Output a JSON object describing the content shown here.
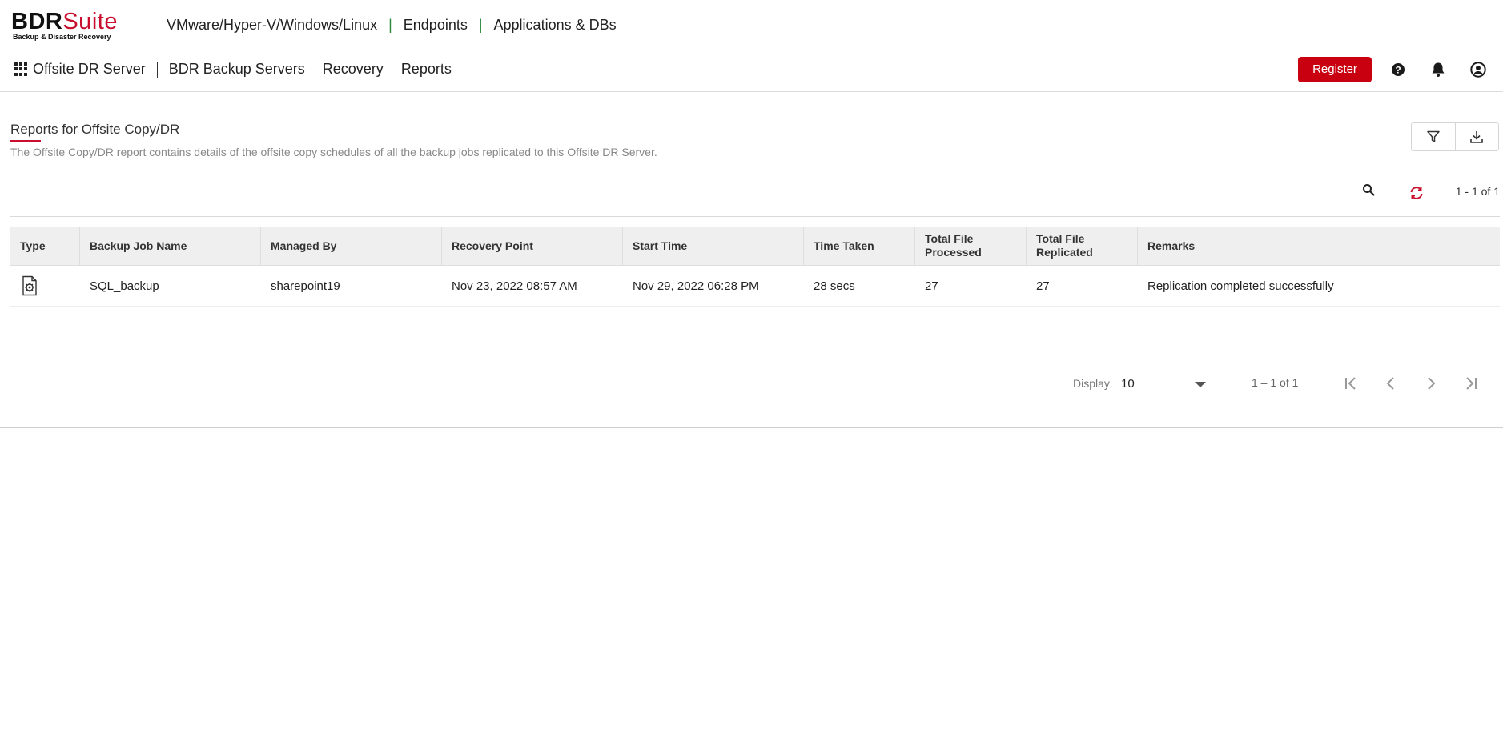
{
  "logo": {
    "brand_prefix": "BDR",
    "brand_suffix": "Suite",
    "tagline": "Backup & Disaster Recovery"
  },
  "product_tabs": [
    {
      "label": "VMware/Hyper-V/Windows/Linux",
      "active": false
    },
    {
      "label": "Endpoints",
      "active": false
    },
    {
      "label": "Applications & DBs",
      "active": true
    }
  ],
  "product_tab_separator": "|",
  "nav": {
    "title": "Offsite DR Server",
    "links": [
      "BDR Backup Servers",
      "Recovery",
      "Reports"
    ],
    "register_label": "Register"
  },
  "page": {
    "title": "Reports for Offsite Copy/DR",
    "description": "The Offsite Copy/DR report contains details of the offsite copy schedules of all the backup jobs replicated to this Offsite DR Server."
  },
  "toolbar": {
    "range_text": "1 - 1 of 1"
  },
  "table": {
    "columns": [
      [
        "Type"
      ],
      [
        "Backup Job Name"
      ],
      [
        "Managed By"
      ],
      [
        "Recovery Point"
      ],
      [
        "Start Time"
      ],
      [
        "Time Taken"
      ],
      [
        "Total File",
        "Processed"
      ],
      [
        "Total File",
        "Replicated"
      ],
      [
        "Remarks"
      ]
    ],
    "rows": [
      {
        "type_icon": "database-job-icon",
        "backup_job_name": "SQL_backup",
        "managed_by": "sharepoint19",
        "recovery_point": "Nov 23, 2022 08:57 AM",
        "start_time": "Nov 29, 2022 06:28 PM",
        "time_taken": "28 secs",
        "total_file_processed": "27",
        "total_file_replicated": "27",
        "remarks": "Replication completed successfully"
      }
    ]
  },
  "pagination": {
    "display_label": "Display",
    "page_size": "10",
    "range_text": "1 – 1 of 1"
  },
  "colors": {
    "accent": "#c8102e",
    "register_bg": "#c8000f",
    "header_bg": "#efefef",
    "separator_green": "#2b8a3e"
  }
}
